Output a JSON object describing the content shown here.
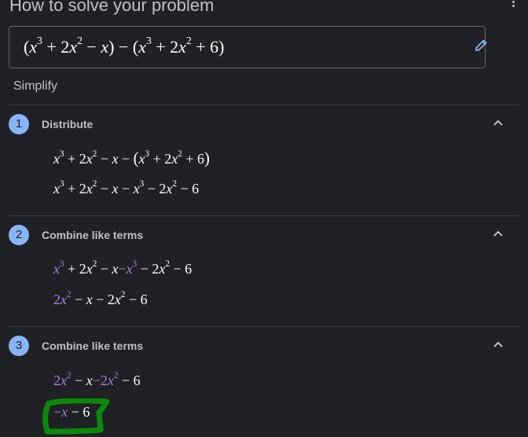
{
  "header": {
    "title": "How to solve your problem",
    "more_icon": "more-vert-icon"
  },
  "problem": {
    "expression": "(x^3 + 2x^2 - x) - (x^3 + 2x^2 + 6)",
    "parts": {
      "open1": "(",
      "x1": "x",
      "e1": "3",
      "p1": " + 2",
      "x2": "x",
      "e2": "2",
      "m1": " − ",
      "x3": "x",
      "close1": ")",
      "minus": " − ",
      "open2": "(",
      "x4": "x",
      "e3": "3",
      "p2": " + 2",
      "x5": "x",
      "e4": "2",
      "p3": " + 6",
      "close2": ")"
    },
    "edit_icon": "pencil-icon"
  },
  "method": "Simplify",
  "colors": {
    "background": "#202124",
    "step_badge": "#8ab4f8",
    "highlight": "#a97fe0",
    "annotation_circle": "#0a8a0a"
  },
  "steps": [
    {
      "number": "1",
      "title": "Distribute",
      "lines": [
        "x^3 + 2x^2 - x - (x^3 + 2x^2 + 6)",
        "x^3 + 2x^2 - x - x^3 - 2x^2 - 6"
      ]
    },
    {
      "number": "2",
      "title": "Combine like terms",
      "lines": [
        "x^3 + 2x^2 - x - x^3 - 2x^2 - 6",
        "2x^2 - x - 2x^2 - 6"
      ]
    },
    {
      "number": "3",
      "title": "Combine like terms",
      "lines": [
        "2x^2 - x - 2x^2 - 6",
        "-x - 6"
      ]
    }
  ],
  "math": {
    "x": "x",
    "two": "2",
    "three": "3",
    "six": "6",
    "plus": " + ",
    "minus": " − ",
    "minus_tight": "−",
    "lparen": "(",
    "rparen": ")",
    "twox": "2x"
  }
}
